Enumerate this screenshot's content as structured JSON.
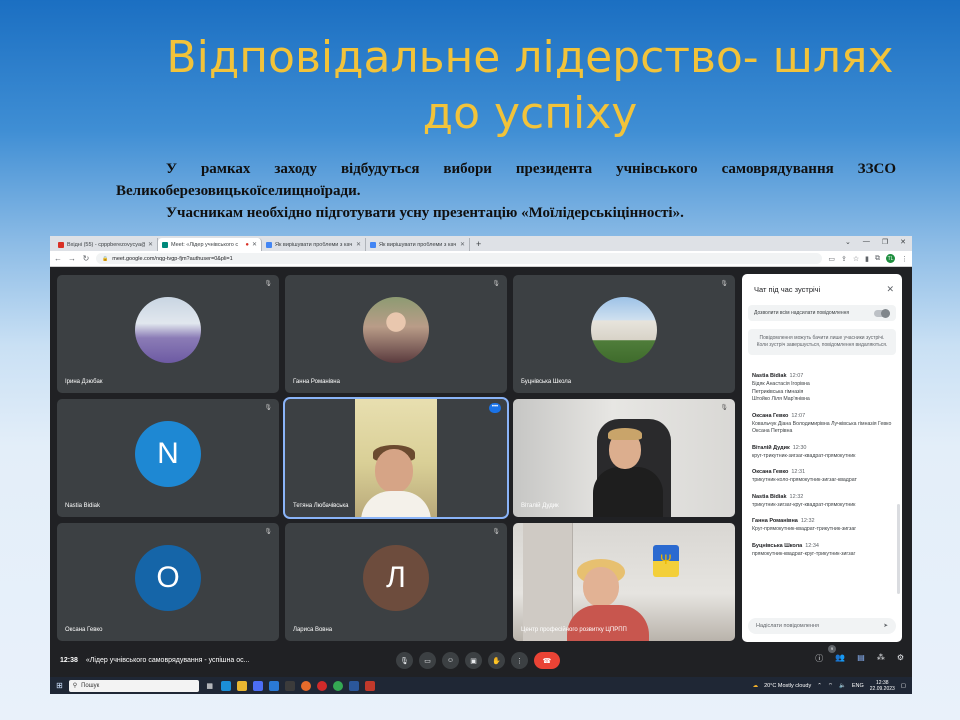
{
  "slide": {
    "title_line1": "Відповідальне лідерство- шлях",
    "title_line2": "до успіху",
    "paragraph1": "У рамках заходу відбудуться вибори президента  учнівського самоврядування ЗЗСО Великоберезовицькоїселищноїради.",
    "paragraph2": "Учасникам необхідно підготувати усну презентацію «Моїлідерськіцінності»."
  },
  "browser": {
    "tabs": [
      {
        "label": "Вхідні (55) - cpppberezovycya@",
        "color": "#d93025"
      },
      {
        "label": "Meet: «Лідер учнівського с",
        "color": "#00897b"
      },
      {
        "label": "Як вирішувати проблеми з кач",
        "color": "#4285f4"
      },
      {
        "label": "Як вирішувати проблеми з кач",
        "color": "#4285f4"
      }
    ],
    "new_tab": "+",
    "url": "meet.google.com/nqg-tvgp-fjm?authuser=0&pli=1",
    "profile_initials": "TL"
  },
  "participants": [
    {
      "name": "Ірина Дзюбак",
      "type": "photo"
    },
    {
      "name": "Ганна Романівна",
      "type": "photo"
    },
    {
      "name": "Буцнівська Школа",
      "type": "photo"
    },
    {
      "name": "Nastia Bidiak",
      "type": "initial",
      "initial": "N",
      "color": "#1e88d3"
    },
    {
      "name": "Тетяна Любачівська",
      "type": "video"
    },
    {
      "name": "Віталій Дудик",
      "type": "video"
    },
    {
      "name": "Оксана Гевко",
      "type": "initial",
      "initial": "O",
      "color": "#1565a8"
    },
    {
      "name": "Лариса Вовна",
      "type": "initial",
      "initial": "Л",
      "color": "#6d4c3d"
    },
    {
      "name": "Центр професійного розвитку ЦПРПП",
      "type": "video"
    }
  ],
  "chat": {
    "title": "Чат під час зустрічі",
    "toggle_label": "Дозволити всім надсилати повідомлення",
    "note": "Повідомлення можуть бачити лише учасники зустрічі. Коли зустріч завершується, повідомлення видаляються.",
    "messages": [
      {
        "author": "Nastia Bidiak",
        "time": "12:07",
        "text": "Бідяк Анастасія Ігорівна\nПетриківська гімназія\nШтойко Ліля Мар'янівна"
      },
      {
        "author": "Оксана Гевко",
        "time": "12:07",
        "text": "Ковальчук Діана Володимирівна Лучківська гімназія Гевко Оксана Петрівна"
      },
      {
        "author": "Віталій Дудик",
        "time": "12:30",
        "text": "круг-трикутник-зигзаг-квадрат-прямокутник"
      },
      {
        "author": "Оксана Гевко",
        "time": "12:31",
        "text": "трикутник-коло-прямокутник-зигзаг-квадрат"
      },
      {
        "author": "Nastia Bidiak",
        "time": "12:32",
        "text": "трикутник-зигзаг-круг-квадрат-прямокутник"
      },
      {
        "author": "Ганна Романівна",
        "time": "12:32",
        "text": "Круг-прямокутник-квадрат-трикутник-зигзаг"
      },
      {
        "author": "Буцнівська Школа",
        "time": "12:34",
        "text": "прямокутник-квадрат-круг-трикутник-зигзаг"
      }
    ],
    "input_placeholder": "Надіслати повідомлення"
  },
  "controls": {
    "time": "12:38",
    "meeting_title": "«Лідер учнівського самоврядування - успішна ос...",
    "participants_badge": "9"
  },
  "taskbar": {
    "search_label": "Пошук",
    "weather": "20°C  Mostly cloudy",
    "language": "ENG",
    "clock_time": "12:38",
    "clock_date": "22.09.2023"
  },
  "colors": {
    "title": "#f2c33a",
    "meet_bg": "#202124",
    "tile_bg": "#3c4043",
    "end_call": "#ea4335"
  }
}
